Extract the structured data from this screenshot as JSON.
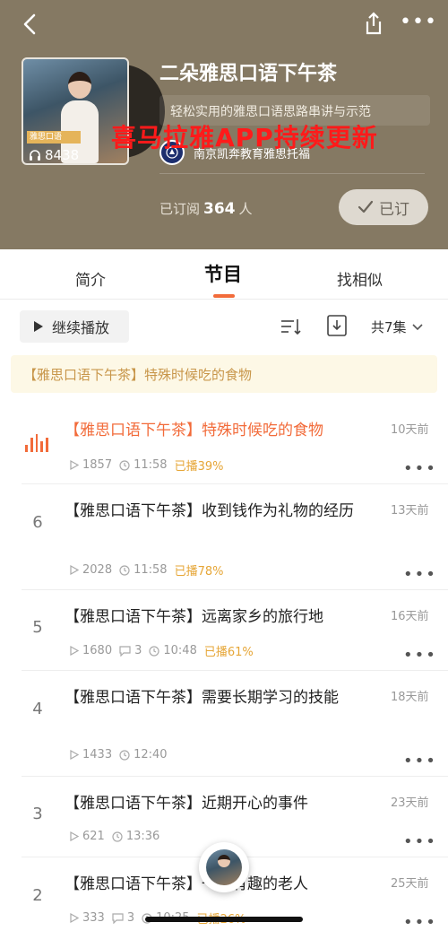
{
  "header": {
    "album_title": "二朵雅思口语下午茶",
    "subtitle": "轻松实用的雅思口语思路串讲与示范",
    "watermark": "喜马拉雅APP持续更新",
    "publisher": "南京凯奔教育雅思托福",
    "cover_plays": "8438",
    "cover_tag": "雅思口语",
    "subscribed_prefix": "已订阅",
    "subscriber_count": "364",
    "subscribed_suffix": "人",
    "subscribe_button": "已订",
    "bg_color": "#857963"
  },
  "tabs": [
    {
      "label": "简介"
    },
    {
      "label": "节目",
      "active": true
    },
    {
      "label": "找相似"
    }
  ],
  "toolbar": {
    "continue_label": "继续播放",
    "episode_count": "共7集"
  },
  "recent_banner": "【雅思口语下午茶】特殊时候吃的食物",
  "accent_color": "#f26b3a",
  "episodes": [
    {
      "num": "",
      "title": "【雅思口语下午茶】特殊时候吃的食物",
      "date": "10天前",
      "plays": "1857",
      "duration": "11:58",
      "progress": "已播39%",
      "playing": true
    },
    {
      "num": "6",
      "title": "【雅思口语下午茶】收到钱作为礼物的经历",
      "date": "13天前",
      "plays": "2028",
      "duration": "11:58",
      "progress": "已播78%"
    },
    {
      "num": "5",
      "title": "【雅思口语下午茶】远离家乡的旅行地",
      "date": "16天前",
      "plays": "1680",
      "comments": "3",
      "duration": "10:48",
      "progress": "已播61%"
    },
    {
      "num": "4",
      "title": "【雅思口语下午茶】需要长期学习的技能",
      "date": "18天前",
      "plays": "1433",
      "duration": "12:40"
    },
    {
      "num": "3",
      "title": "【雅思口语下午茶】近期开心的事件",
      "date": "23天前",
      "plays": "621",
      "duration": "13:36"
    },
    {
      "num": "2",
      "title": "【雅思口语下午茶】一个有趣的老人",
      "date": "25天前",
      "plays": "333",
      "comments": "3",
      "duration": "10:25",
      "progress": "已播26%"
    }
  ]
}
